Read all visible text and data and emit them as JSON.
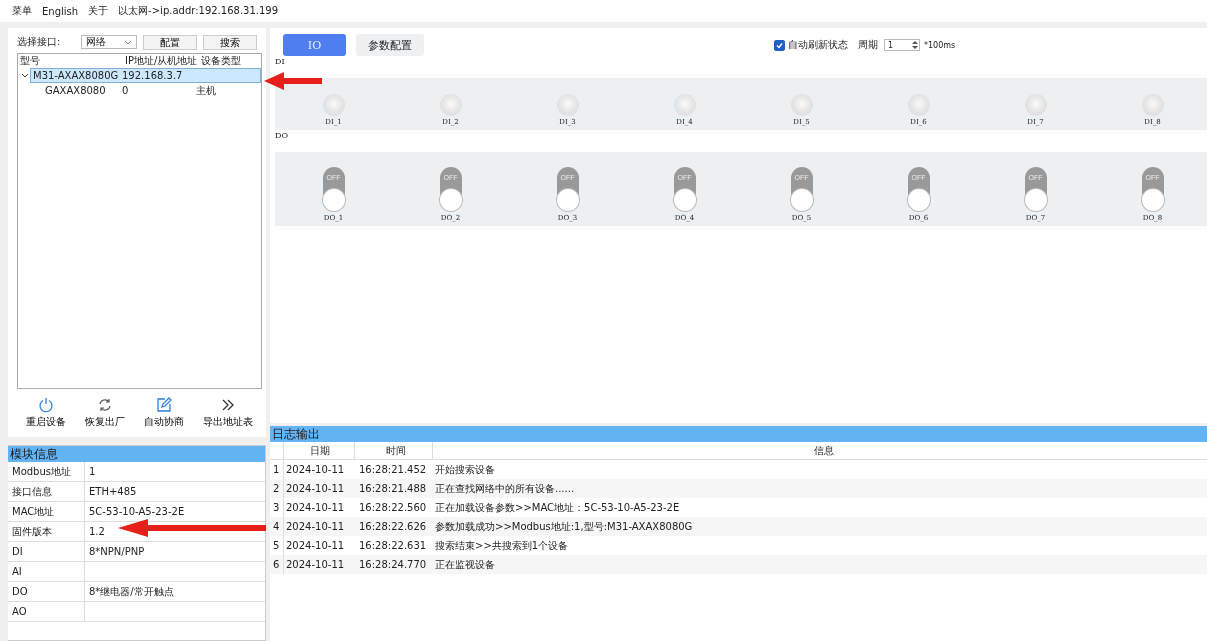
{
  "menu_bar": {
    "items": [
      "菜单",
      "English",
      "关于"
    ],
    "status": "以太网->ip.addr:192.168.31.199"
  },
  "left_panel": {
    "interface_label": "选择接口:",
    "interface_value": "网络",
    "buttons": [
      "配置",
      "搜索"
    ],
    "tree": {
      "columns": [
        "型号",
        "IP地址/从机地址",
        "设备类型"
      ],
      "rows": [
        {
          "cells": [
            "M31-AXAX8080G",
            "192.168.3.7",
            ""
          ],
          "expanded": true,
          "selected": true,
          "children": [
            {
              "cells": [
                "GAXAX8080",
                "0",
                "主机"
              ],
              "selected": false
            }
          ]
        }
      ]
    },
    "actions": [
      {
        "kind": "power",
        "label": "重启设备"
      },
      {
        "kind": "refresh",
        "label": "恢复出厂"
      },
      {
        "kind": "edit",
        "label": "自动协商"
      },
      {
        "kind": "chevrons",
        "label": "导出地址表"
      }
    ]
  },
  "module_info": {
    "title": "模块信息",
    "rows": [
      [
        "Modbus地址",
        "1"
      ],
      [
        "接口信息",
        "ETH+485"
      ],
      [
        "MAC地址",
        "5C-53-10-A5-23-2E"
      ],
      [
        "固件版本",
        "1.2"
      ],
      [
        "DI",
        "8*NPN/PNP"
      ],
      [
        "AI",
        ""
      ],
      [
        "DO",
        "8*继电器/常开触点"
      ],
      [
        "AO",
        ""
      ]
    ]
  },
  "tabs": [
    {
      "label": "IO",
      "selected": true
    },
    {
      "label": "参数配置",
      "selected": false
    }
  ],
  "auto_refresh": {
    "label": "自动刷新状态",
    "checked": true,
    "period_label": "周期",
    "period_value": "1",
    "unit": "*100ms"
  },
  "di": {
    "label": "DI",
    "items": [
      {
        "label": "DI_1",
        "on": false
      },
      {
        "label": "DI_2",
        "on": false
      },
      {
        "label": "DI_3",
        "on": false
      },
      {
        "label": "DI_4",
        "on": false
      },
      {
        "label": "DI_5",
        "on": false
      },
      {
        "label": "DI_6",
        "on": false
      },
      {
        "label": "DI_7",
        "on": false
      },
      {
        "label": "DI_8",
        "on": false
      }
    ]
  },
  "do": {
    "label": "DO",
    "items": [
      {
        "label": "DO_1",
        "state": "OFF",
        "on": false
      },
      {
        "label": "DO_2",
        "state": "OFF",
        "on": false
      },
      {
        "label": "DO_3",
        "state": "OFF",
        "on": false
      },
      {
        "label": "DO_4",
        "state": "OFF",
        "on": false
      },
      {
        "label": "DO_5",
        "state": "OFF",
        "on": false
      },
      {
        "label": "DO_6",
        "state": "OFF",
        "on": false
      },
      {
        "label": "DO_7",
        "state": "OFF",
        "on": false
      },
      {
        "label": "DO_8",
        "state": "OFF",
        "on": false
      }
    ]
  },
  "log": {
    "title": "日志输出",
    "columns": [
      "",
      "日期",
      "时间",
      "信息"
    ],
    "rows": [
      [
        "1",
        "2024-10-11",
        "16:28:21.452",
        "开始搜索设备"
      ],
      [
        "2",
        "2024-10-11",
        "16:28:21.488",
        "正在查找网络中的所有设备......"
      ],
      [
        "3",
        "2024-10-11",
        "16:28:22.560",
        "正在加载设备参数>>MAC地址：5C-53-10-A5-23-2E"
      ],
      [
        "4",
        "2024-10-11",
        "16:28:22.626",
        "参数加载成功>>Modbus地址:1,型号:M31-AXAX8080G"
      ],
      [
        "5",
        "2024-10-11",
        "16:28:22.631",
        "搜索结束>>共搜索到1个设备"
      ],
      [
        "6",
        "2024-10-11",
        "16:28:24.770",
        "正在监视设备"
      ]
    ]
  }
}
